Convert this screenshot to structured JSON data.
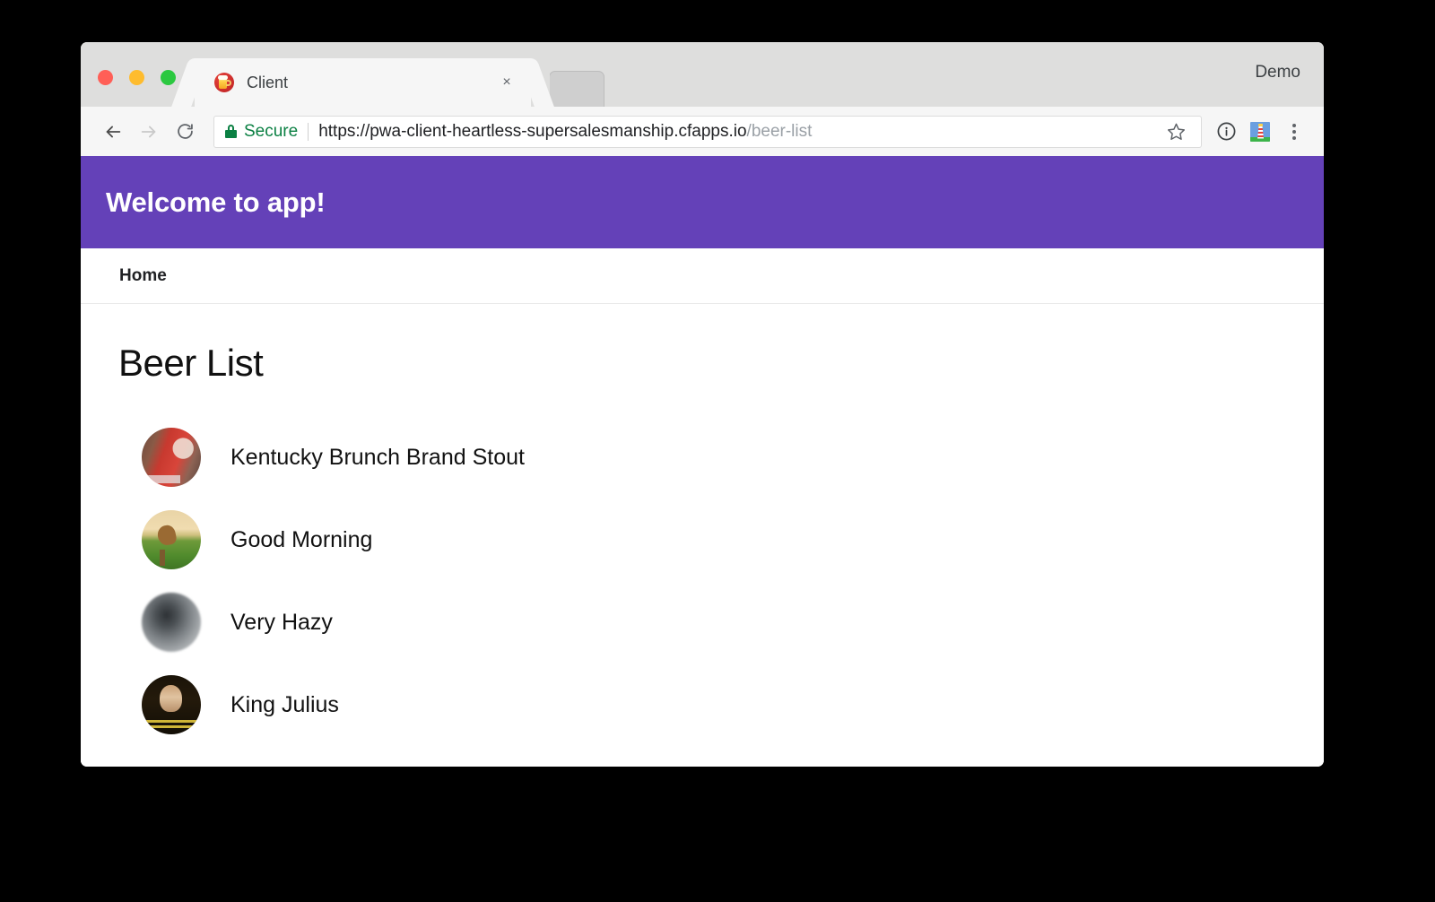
{
  "browser": {
    "window_controls": [
      {
        "name": "close",
        "color": "#ff5f57"
      },
      {
        "name": "minimize",
        "color": "#febc2e"
      },
      {
        "name": "maximize",
        "color": "#2bc840"
      }
    ],
    "tabs": [
      {
        "title": "Client",
        "favicon": "beer-mug-icon",
        "active": true
      },
      {
        "title": "",
        "favicon": "",
        "active": false
      }
    ],
    "tab_close_label": "×",
    "profile_label": "Demo",
    "toolbar": {
      "back_icon": "arrow-left-icon",
      "forward_icon": "arrow-right-icon",
      "reload_icon": "reload-icon",
      "security_icon": "lock-icon",
      "security_label": "Secure",
      "url_scheme_host": "https://pwa-client-heartless-supersalesmanship.cfapps.io",
      "url_path": "/beer-list",
      "bookmark_icon": "star-icon",
      "page_info_icon": "info-circle-icon",
      "extension_icon": "lighthouse-icon",
      "menu_icon": "three-dot-menu-icon"
    }
  },
  "page": {
    "header": {
      "title": "Welcome to app!",
      "background": "#6441b8"
    },
    "nav": {
      "links": [
        {
          "label": "Home"
        }
      ]
    },
    "main": {
      "heading": "Beer List",
      "beers": [
        {
          "name": "Kentucky Brunch Brand Stout",
          "avatar": "av-stout"
        },
        {
          "name": "Good Morning",
          "avatar": "av-morning"
        },
        {
          "name": "Very Hazy",
          "avatar": "av-hazy"
        },
        {
          "name": "King Julius",
          "avatar": "av-king"
        }
      ]
    }
  }
}
